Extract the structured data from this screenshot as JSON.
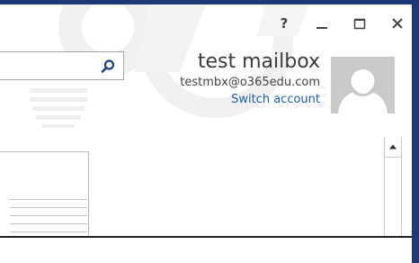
{
  "window": {
    "controls": {
      "help_label": "?"
    }
  },
  "search": {
    "value": "",
    "placeholder": ""
  },
  "account": {
    "name": "test mailbox",
    "email": "testmbx@o365edu.com",
    "switch_label": "Switch account"
  },
  "colors": {
    "window_border": "#1a3a7a",
    "link": "#1f5fa8",
    "avatar_bg": "#c9c9c9"
  },
  "icons": {
    "search": "search-icon",
    "minimize": "minimize-icon",
    "maximize": "maximize-icon",
    "close": "close-icon",
    "avatar": "default-user-avatar",
    "scroll_up": "scroll-up-arrow-icon"
  }
}
